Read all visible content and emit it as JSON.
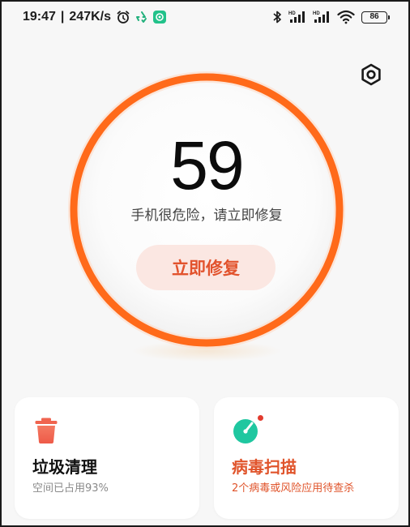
{
  "status_bar": {
    "time": "19:47",
    "separator": "|",
    "net_speed": "247K/s",
    "battery": "86",
    "icons": [
      "alarm-icon",
      "recycle-icon",
      "app-badge-icon",
      "bluetooth-icon",
      "signal-hd-icon",
      "signal-hd-icon",
      "wifi-icon",
      "battery-icon"
    ]
  },
  "header": {
    "settings_icon": "hexagon-settings-icon"
  },
  "score": {
    "value": "59",
    "subtitle": "手机很危险，请立即修复",
    "button_label": "立即修复",
    "ring_color": "#ff6a1a"
  },
  "cards": {
    "junk": {
      "title": "垃圾清理",
      "desc": "空间已占用93%",
      "icon": "trash-icon",
      "icon_color": "#f0644f"
    },
    "virus": {
      "title": "病毒扫描",
      "desc": "2个病毒或风险应用待查杀",
      "icon": "virus-scan-icon",
      "icon_color": "#1fc7a0",
      "accent": "#e0542b"
    }
  }
}
